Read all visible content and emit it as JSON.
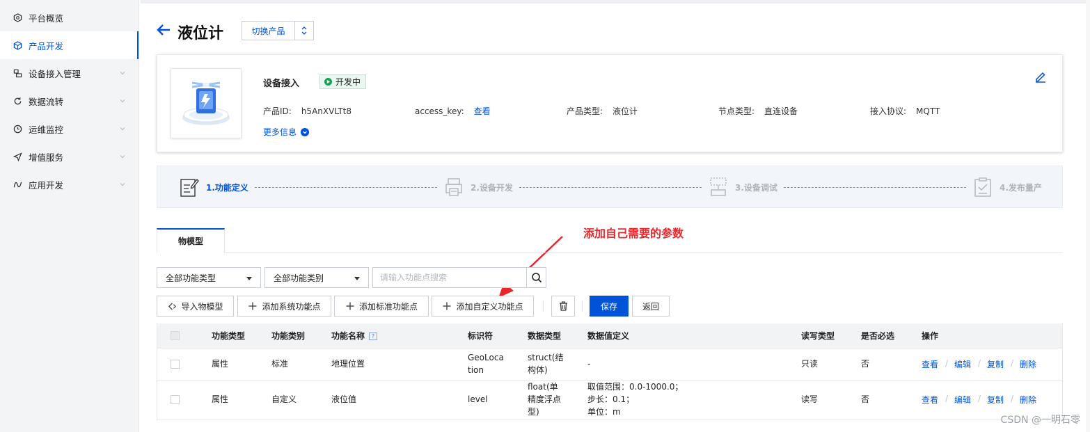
{
  "sidebar": {
    "items": [
      {
        "label": "平台概览"
      },
      {
        "label": "产品开发"
      },
      {
        "label": "设备接入管理"
      },
      {
        "label": "数据流转"
      },
      {
        "label": "运维监控"
      },
      {
        "label": "增值服务"
      },
      {
        "label": "应用开发"
      }
    ]
  },
  "header": {
    "title": "液位计",
    "switch_label": "切换产品"
  },
  "product": {
    "access_title": "设备接入",
    "status": "开发中",
    "fields": [
      {
        "key": "产品ID:",
        "value": "h5AnXVLTt8"
      },
      {
        "key": "access_key:",
        "value": "查看"
      },
      {
        "key": "产品类型:",
        "value": "液位计"
      },
      {
        "key": "节点类型:",
        "value": "直连设备"
      },
      {
        "key": "接入协议:",
        "value": "MQTT"
      }
    ],
    "more_info": "更多信息"
  },
  "steps": [
    {
      "label": "1.功能定义"
    },
    {
      "label": "2.设备开发"
    },
    {
      "label": "3.设备调试"
    },
    {
      "label": "4.发布量产"
    }
  ],
  "annotation": "添加自己需要的参数",
  "tabs": [
    {
      "label": "物模型"
    }
  ],
  "filters": {
    "type_select": "全部功能类型",
    "category_select": "全部功能类别",
    "search_placeholder": "请输入功能点搜索"
  },
  "actions": {
    "import": "导入物模型",
    "add_system": "添加系统功能点",
    "add_standard": "添加标准功能点",
    "add_custom": "添加自定义功能点",
    "save": "保存",
    "back": "返回"
  },
  "table": {
    "headers": [
      "功能类型",
      "功能类别",
      "功能名称",
      "标识符",
      "数据类型",
      "数据值定义",
      "读写类型",
      "是否必选",
      "操作"
    ],
    "rows": [
      {
        "type": "属性",
        "category": "标准",
        "name": "地理位置",
        "identifier": [
          "GeoLoca",
          "tion"
        ],
        "data_type": [
          "struct(结",
          "构体)"
        ],
        "definition": [
          "-"
        ],
        "rw": "只读",
        "required": "否"
      },
      {
        "type": "属性",
        "category": "自定义",
        "name": "液位值",
        "identifier": [
          "level"
        ],
        "data_type": [
          "float(单",
          "精度浮点",
          "型)"
        ],
        "definition": [
          "取值范围：0.0-1000.0；",
          "步长：0.1；",
          "单位：m"
        ],
        "rw": "读写",
        "required": "否"
      }
    ],
    "ops": [
      "查看",
      "编辑",
      "复制",
      "删除"
    ]
  },
  "watermark": "CSDN @一明石零",
  "colors": {
    "accent": "#0052d9",
    "annotation": "#e8262c",
    "status_green": "#18a058"
  }
}
